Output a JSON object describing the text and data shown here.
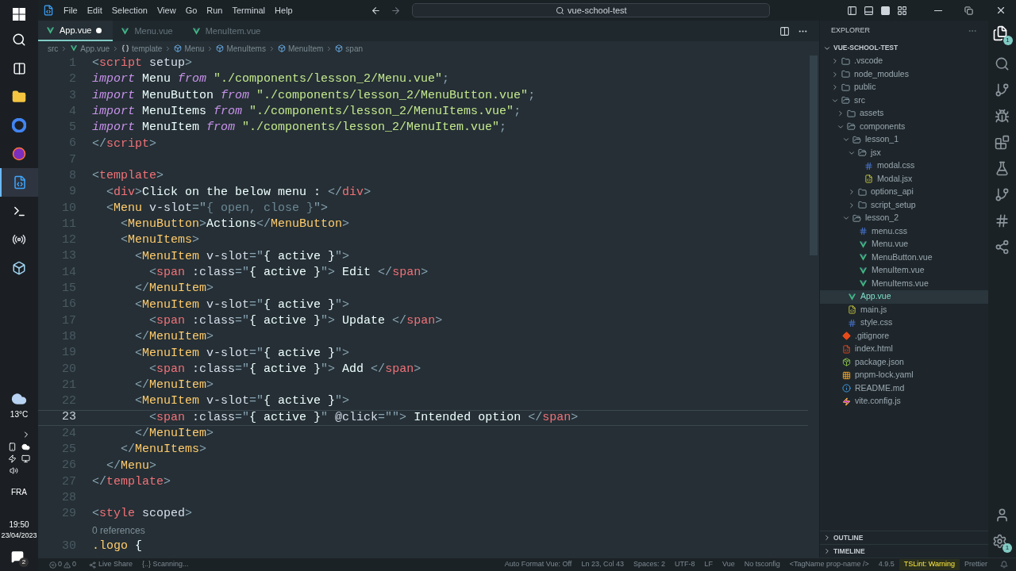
{
  "taskbar": {
    "apps": [
      {
        "kind": "search",
        "selected": false
      },
      {
        "kind": "taskview",
        "selected": false
      },
      {
        "kind": "files",
        "selected": false
      },
      {
        "kind": "chrome",
        "selected": false
      },
      {
        "kind": "firefox",
        "selected": false
      },
      {
        "kind": "vscode",
        "selected": true
      },
      {
        "kind": "terminal",
        "selected": false
      },
      {
        "kind": "ring",
        "selected": false
      },
      {
        "kind": "box",
        "selected": false
      }
    ],
    "weather": "13°C",
    "language": "FRA",
    "time": "19:50",
    "date": "23/04/2023",
    "notifications": "2"
  },
  "menu": [
    "File",
    "Edit",
    "Selection",
    "View",
    "Go",
    "Run",
    "Terminal",
    "Help"
  ],
  "command_center": "vue-school-test",
  "tabs": [
    {
      "label": "App.vue",
      "selected": true,
      "modified": true
    },
    {
      "label": "Menu.vue",
      "selected": false,
      "modified": false
    },
    {
      "label": "MenuItem.vue",
      "selected": false,
      "modified": false
    }
  ],
  "breadcrumb": [
    {
      "kind": "folder",
      "label": "src"
    },
    {
      "kind": "vue",
      "label": "App.vue"
    },
    {
      "kind": "braces",
      "label": "template"
    },
    {
      "kind": "element",
      "label": "Menu"
    },
    {
      "kind": "element",
      "label": "MenuItems"
    },
    {
      "kind": "element",
      "label": "MenuItem"
    },
    {
      "kind": "element",
      "label": "span"
    }
  ],
  "editor": {
    "lines": [
      {
        "kind": "code",
        "n": "1",
        "current": false,
        "tokens": [
          {
            "kind": "p",
            "text": "<"
          },
          {
            "kind": "tag",
            "text": "script"
          },
          {
            "kind": "attr",
            "text": " setup"
          },
          {
            "kind": "p",
            "text": ">"
          }
        ]
      },
      {
        "kind": "code",
        "n": "2",
        "current": false,
        "tokens": [
          {
            "kind": "kw",
            "text": "import"
          },
          {
            "kind": "t",
            "text": " Menu "
          },
          {
            "kind": "kw",
            "text": "from"
          },
          {
            "kind": "str",
            "text": " \"./components/lesson_2/Menu.vue\""
          },
          {
            "kind": "p",
            "text": ";"
          }
        ]
      },
      {
        "kind": "code",
        "n": "3",
        "current": false,
        "tokens": [
          {
            "kind": "kw",
            "text": "import"
          },
          {
            "kind": "t",
            "text": " MenuButton "
          },
          {
            "kind": "kw",
            "text": "from"
          },
          {
            "kind": "str",
            "text": " \"./components/lesson_2/MenuButton.vue\""
          },
          {
            "kind": "p",
            "text": ";"
          }
        ]
      },
      {
        "kind": "code",
        "n": "4",
        "current": false,
        "tokens": [
          {
            "kind": "kw",
            "text": "import"
          },
          {
            "kind": "t",
            "text": " MenuItems "
          },
          {
            "kind": "kw",
            "text": "from"
          },
          {
            "kind": "str",
            "text": " \"./components/lesson_2/MenuItems.vue\""
          },
          {
            "kind": "p",
            "text": ";"
          }
        ]
      },
      {
        "kind": "code",
        "n": "5",
        "current": false,
        "tokens": [
          {
            "kind": "kw",
            "text": "import"
          },
          {
            "kind": "t",
            "text": " MenuItem "
          },
          {
            "kind": "kw",
            "text": "from"
          },
          {
            "kind": "str",
            "text": " \"./components/lesson_2/MenuItem.vue\""
          },
          {
            "kind": "p",
            "text": ";"
          }
        ]
      },
      {
        "kind": "code",
        "n": "6",
        "current": false,
        "tokens": [
          {
            "kind": "p",
            "text": "</"
          },
          {
            "kind": "tag",
            "text": "script"
          },
          {
            "kind": "p",
            "text": ">"
          }
        ]
      },
      {
        "kind": "code",
        "n": "7",
        "current": false
      },
      {
        "kind": "code",
        "n": "8",
        "current": false,
        "tokens": [
          {
            "kind": "p",
            "text": "<"
          },
          {
            "kind": "tag",
            "text": "template"
          },
          {
            "kind": "p",
            "text": ">"
          }
        ]
      },
      {
        "kind": "code",
        "n": "9",
        "current": false,
        "tokens": [
          {
            "kind": "p",
            "text": "  <"
          },
          {
            "kind": "tag",
            "text": "div"
          },
          {
            "kind": "p",
            "text": ">"
          },
          {
            "kind": "t",
            "text": "Click on the below menu : "
          },
          {
            "kind": "p",
            "text": "</"
          },
          {
            "kind": "tag",
            "text": "div"
          },
          {
            "kind": "p",
            "text": ">"
          }
        ]
      },
      {
        "kind": "code",
        "n": "10",
        "current": false,
        "tokens": [
          {
            "kind": "p",
            "text": "  <"
          },
          {
            "kind": "comp",
            "text": "Menu"
          },
          {
            "kind": "attr",
            "text": " v-slot"
          },
          {
            "kind": "p",
            "text": "=\""
          },
          {
            "kind": "dim",
            "text": "{ open, close }"
          },
          {
            "kind": "p",
            "text": "\">"
          }
        ]
      },
      {
        "kind": "code",
        "n": "11",
        "current": false,
        "tokens": [
          {
            "kind": "p",
            "text": "    <"
          },
          {
            "kind": "comp",
            "text": "MenuButton"
          },
          {
            "kind": "p",
            "text": ">"
          },
          {
            "kind": "t",
            "text": "Actions"
          },
          {
            "kind": "p",
            "text": "</"
          },
          {
            "kind": "comp",
            "text": "MenuButton"
          },
          {
            "kind": "p",
            "text": ">"
          }
        ]
      },
      {
        "kind": "code",
        "n": "12",
        "current": false,
        "tokens": [
          {
            "kind": "p",
            "text": "    <"
          },
          {
            "kind": "comp",
            "text": "MenuItems"
          },
          {
            "kind": "p",
            "text": ">"
          }
        ]
      },
      {
        "kind": "code",
        "n": "13",
        "current": false,
        "tokens": [
          {
            "kind": "p",
            "text": "      <"
          },
          {
            "kind": "comp",
            "text": "MenuItem"
          },
          {
            "kind": "attr",
            "text": " v-slot"
          },
          {
            "kind": "p",
            "text": "=\""
          },
          {
            "kind": "t",
            "text": "{ active }"
          },
          {
            "kind": "p",
            "text": "\">"
          }
        ]
      },
      {
        "kind": "code",
        "n": "14",
        "current": false,
        "tokens": [
          {
            "kind": "p",
            "text": "        <"
          },
          {
            "kind": "tag",
            "text": "span"
          },
          {
            "kind": "attr",
            "text": " :class"
          },
          {
            "kind": "p",
            "text": "=\""
          },
          {
            "kind": "t",
            "text": "{ active }"
          },
          {
            "kind": "p",
            "text": "\">"
          },
          {
            "kind": "t",
            "text": " Edit "
          },
          {
            "kind": "p",
            "text": "</"
          },
          {
            "kind": "tag",
            "text": "span"
          },
          {
            "kind": "p",
            "text": ">"
          }
        ]
      },
      {
        "kind": "code",
        "n": "15",
        "current": false,
        "tokens": [
          {
            "kind": "p",
            "text": "      </"
          },
          {
            "kind": "comp",
            "text": "MenuItem"
          },
          {
            "kind": "p",
            "text": ">"
          }
        ]
      },
      {
        "kind": "code",
        "n": "16",
        "current": false,
        "tokens": [
          {
            "kind": "p",
            "text": "      <"
          },
          {
            "kind": "comp",
            "text": "MenuItem"
          },
          {
            "kind": "attr",
            "text": " v-slot"
          },
          {
            "kind": "p",
            "text": "=\""
          },
          {
            "kind": "t",
            "text": "{ active }"
          },
          {
            "kind": "p",
            "text": "\">"
          }
        ]
      },
      {
        "kind": "code",
        "n": "17",
        "current": false,
        "tokens": [
          {
            "kind": "p",
            "text": "        <"
          },
          {
            "kind": "tag",
            "text": "span"
          },
          {
            "kind": "attr",
            "text": " :class"
          },
          {
            "kind": "p",
            "text": "=\""
          },
          {
            "kind": "t",
            "text": "{ active }"
          },
          {
            "kind": "p",
            "text": "\">"
          },
          {
            "kind": "t",
            "text": " Update "
          },
          {
            "kind": "p",
            "text": "</"
          },
          {
            "kind": "tag",
            "text": "span"
          },
          {
            "kind": "p",
            "text": ">"
          }
        ]
      },
      {
        "kind": "code",
        "n": "18",
        "current": false,
        "tokens": [
          {
            "kind": "p",
            "text": "      </"
          },
          {
            "kind": "comp",
            "text": "MenuItem"
          },
          {
            "kind": "p",
            "text": ">"
          }
        ]
      },
      {
        "kind": "code",
        "n": "19",
        "current": false,
        "tokens": [
          {
            "kind": "p",
            "text": "      <"
          },
          {
            "kind": "comp",
            "text": "MenuItem"
          },
          {
            "kind": "attr",
            "text": " v-slot"
          },
          {
            "kind": "p",
            "text": "=\""
          },
          {
            "kind": "t",
            "text": "{ active }"
          },
          {
            "kind": "p",
            "text": "\">"
          }
        ]
      },
      {
        "kind": "code",
        "n": "20",
        "current": false,
        "tokens": [
          {
            "kind": "p",
            "text": "        <"
          },
          {
            "kind": "tag",
            "text": "span"
          },
          {
            "kind": "attr",
            "text": " :class"
          },
          {
            "kind": "p",
            "text": "=\""
          },
          {
            "kind": "t",
            "text": "{ active }"
          },
          {
            "kind": "p",
            "text": "\">"
          },
          {
            "kind": "t",
            "text": " Add "
          },
          {
            "kind": "p",
            "text": "</"
          },
          {
            "kind": "tag",
            "text": "span"
          },
          {
            "kind": "p",
            "text": ">"
          }
        ]
      },
      {
        "kind": "code",
        "n": "21",
        "current": false,
        "tokens": [
          {
            "kind": "p",
            "text": "      </"
          },
          {
            "kind": "comp",
            "text": "MenuItem"
          },
          {
            "kind": "p",
            "text": ">"
          }
        ]
      },
      {
        "kind": "code",
        "n": "22",
        "current": false,
        "tokens": [
          {
            "kind": "p",
            "text": "      <"
          },
          {
            "kind": "comp",
            "text": "MenuItem"
          },
          {
            "kind": "attr",
            "text": " v-slot"
          },
          {
            "kind": "p",
            "text": "=\""
          },
          {
            "kind": "t",
            "text": "{ active }"
          },
          {
            "kind": "p",
            "text": "\">"
          }
        ]
      },
      {
        "kind": "code",
        "n": "23",
        "current": true,
        "tokens": [
          {
            "kind": "p",
            "text": "        <"
          },
          {
            "kind": "tag",
            "text": "span"
          },
          {
            "kind": "attr",
            "text": " :class"
          },
          {
            "kind": "p",
            "text": "=\""
          },
          {
            "kind": "t",
            "text": "{ active }"
          },
          {
            "kind": "p",
            "text": "\" "
          },
          {
            "kind": "attr",
            "text": "@click"
          },
          {
            "kind": "p",
            "text": "=\"\">"
          },
          {
            "kind": "t",
            "text": " Intended option "
          },
          {
            "kind": "p",
            "text": "</"
          },
          {
            "kind": "tag",
            "text": "span"
          },
          {
            "kind": "p",
            "text": ">"
          }
        ]
      },
      {
        "kind": "code",
        "n": "24",
        "current": false,
        "tokens": [
          {
            "kind": "p",
            "text": "      </"
          },
          {
            "kind": "comp",
            "text": "MenuItem"
          },
          {
            "kind": "p",
            "text": ">"
          }
        ]
      },
      {
        "kind": "code",
        "n": "25",
        "current": false,
        "tokens": [
          {
            "kind": "p",
            "text": "    </"
          },
          {
            "kind": "comp",
            "text": "MenuItems"
          },
          {
            "kind": "p",
            "text": ">"
          }
        ]
      },
      {
        "kind": "code",
        "n": "26",
        "current": false,
        "tokens": [
          {
            "kind": "p",
            "text": "  </"
          },
          {
            "kind": "comp",
            "text": "Menu"
          },
          {
            "kind": "p",
            "text": ">"
          }
        ]
      },
      {
        "kind": "code",
        "n": "27",
        "current": false,
        "tokens": [
          {
            "kind": "p",
            "text": "</"
          },
          {
            "kind": "tag",
            "text": "template"
          },
          {
            "kind": "p",
            "text": ">"
          }
        ]
      },
      {
        "kind": "code",
        "n": "28",
        "current": false
      },
      {
        "kind": "code",
        "n": "29",
        "current": false,
        "tokens": [
          {
            "kind": "p",
            "text": "<"
          },
          {
            "kind": "tag",
            "text": "style"
          },
          {
            "kind": "attr",
            "text": " scoped"
          },
          {
            "kind": "p",
            "text": ">"
          }
        ]
      },
      {
        "kind": "codelens",
        "text": "0 references"
      },
      {
        "kind": "code",
        "n": "30",
        "current": false,
        "tokens": [
          {
            "kind": "sel",
            "text": ".logo"
          },
          {
            "kind": "t",
            "text": " {"
          }
        ]
      }
    ]
  },
  "explorer": {
    "title": "EXPLORER",
    "root": {
      "label": "VUE-SCHOOL-TEST",
      "expanded": true
    },
    "tree": [
      {
        "kind": "folder",
        "label": ".vscode",
        "expanded": false,
        "selected": false
      },
      {
        "kind": "folder",
        "label": "node_modules",
        "expanded": false,
        "selected": false
      },
      {
        "kind": "folder",
        "label": "public",
        "expanded": false,
        "selected": false
      },
      {
        "kind": "folder",
        "label": "src",
        "expanded": true,
        "selected": false,
        "children": [
          {
            "kind": "folder",
            "label": "assets",
            "expanded": false,
            "selected": false
          },
          {
            "kind": "folder",
            "label": "components",
            "expanded": true,
            "selected": false,
            "children": [
              {
                "kind": "folder",
                "label": "lesson_1",
                "expanded": true,
                "selected": false,
                "children": [
                  {
                    "kind": "folder",
                    "label": "jsx",
                    "expanded": true,
                    "selected": false,
                    "children": [
                      {
                        "kind": "css",
                        "label": "modal.css",
                        "selected": false
                      },
                      {
                        "kind": "jsx",
                        "label": "Modal.jsx",
                        "selected": false
                      }
                    ]
                  },
                  {
                    "kind": "folder",
                    "label": "options_api",
                    "expanded": false,
                    "selected": false
                  },
                  {
                    "kind": "folder",
                    "label": "script_setup",
                    "expanded": false,
                    "selected": false
                  }
                ]
              },
              {
                "kind": "folder",
                "label": "lesson_2",
                "expanded": true,
                "selected": false,
                "children": [
                  {
                    "kind": "css",
                    "label": "menu.css",
                    "selected": false
                  },
                  {
                    "kind": "vue",
                    "label": "Menu.vue",
                    "selected": false
                  },
                  {
                    "kind": "vue",
                    "label": "MenuButton.vue",
                    "selected": false
                  },
                  {
                    "kind": "vue",
                    "label": "MenuItem.vue",
                    "selected": false
                  },
                  {
                    "kind": "vue",
                    "label": "MenuItems.vue",
                    "selected": false
                  }
                ]
              }
            ]
          },
          {
            "kind": "vue",
            "label": "App.vue",
            "selected": true
          },
          {
            "kind": "js",
            "label": "main.js",
            "selected": false
          },
          {
            "kind": "css",
            "label": "style.css",
            "selected": false
          }
        ]
      },
      {
        "kind": "git",
        "label": ".gitignore",
        "selected": false
      },
      {
        "kind": "html",
        "label": "index.html",
        "selected": false
      },
      {
        "kind": "json",
        "label": "package.json",
        "selected": false
      },
      {
        "kind": "yaml",
        "label": "pnpm-lock.yaml",
        "selected": false
      },
      {
        "kind": "info",
        "label": "README.md",
        "selected": false
      },
      {
        "kind": "vite",
        "label": "vite.config.js",
        "selected": false
      }
    ],
    "sections": [
      {
        "label": "OUTLINE",
        "expanded": false
      },
      {
        "label": "TIMELINE",
        "expanded": false
      }
    ]
  },
  "activity_badges": {
    "explorer": "1",
    "settings": "1"
  },
  "status_bar": {
    "left": [
      {
        "kind": "problems",
        "errors": "0",
        "warnings": "0"
      },
      {
        "kind": "liveshare",
        "label": "Live Share"
      },
      {
        "kind": "text",
        "label": "{..} Scanning..."
      }
    ],
    "right": [
      {
        "label": "Auto Format Vue: Off",
        "warning": false
      },
      {
        "label": "Ln 23, Col 43",
        "warning": false
      },
      {
        "label": "Spaces: 2",
        "warning": false
      },
      {
        "label": "UTF-8",
        "warning": false
      },
      {
        "label": "LF",
        "warning": false
      },
      {
        "label": "Vue",
        "warning": false
      },
      {
        "label": "No tsconfig",
        "warning": false
      },
      {
        "label": "<TagName prop-name />",
        "warning": false
      },
      {
        "label": "4.9.5",
        "warning": false
      },
      {
        "label": "TSLint: Warning",
        "warning": true
      },
      {
        "label": "Prettier",
        "warning": false
      }
    ]
  }
}
